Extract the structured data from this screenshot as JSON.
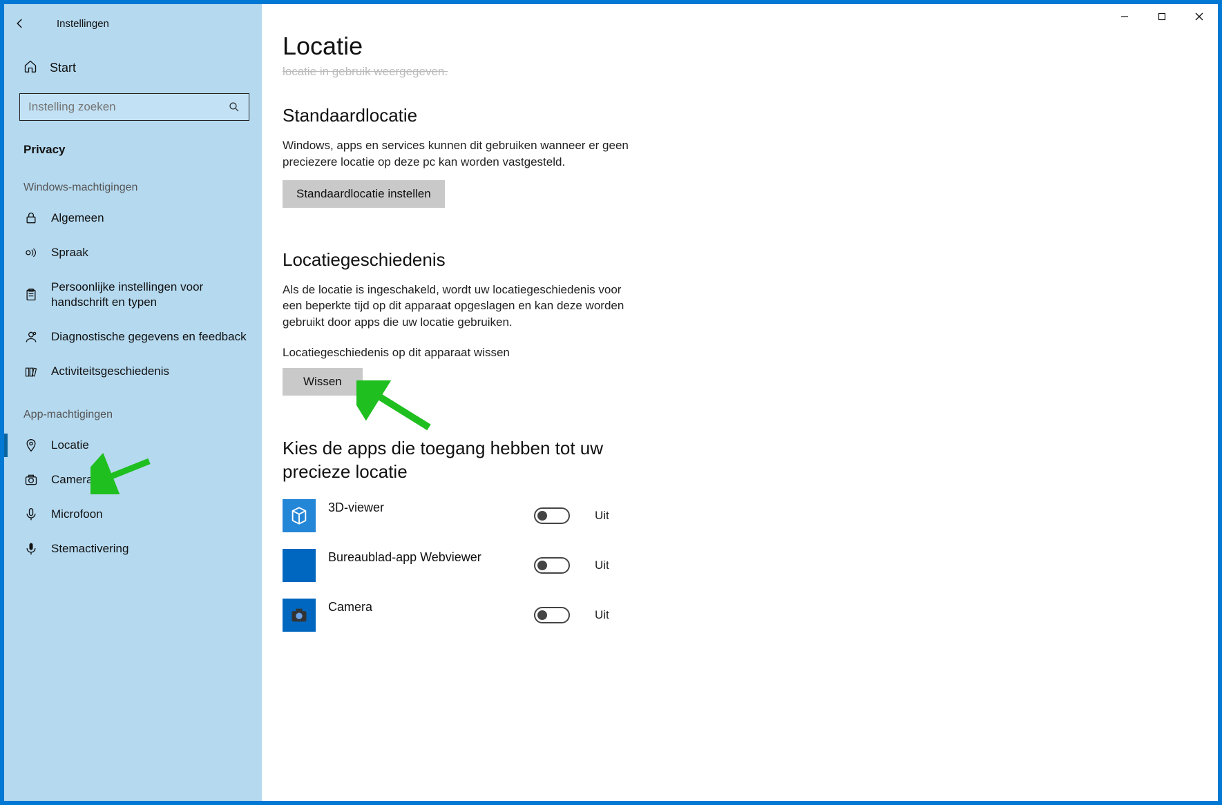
{
  "window": {
    "title": "Instellingen"
  },
  "sidebar": {
    "home": "Start",
    "search_placeholder": "Instelling zoeken",
    "category": "Privacy",
    "group_windows": "Windows-machtigingen",
    "group_apps": "App-machtigingen",
    "items_windows": [
      {
        "label": "Algemeen"
      },
      {
        "label": "Spraak"
      },
      {
        "label": "Persoonlijke instellingen voor handschrift en typen"
      },
      {
        "label": "Diagnostische gegevens en feedback"
      },
      {
        "label": "Activiteitsgeschiedenis"
      }
    ],
    "items_apps": [
      {
        "label": "Locatie"
      },
      {
        "label": "Camera"
      },
      {
        "label": "Microfoon"
      },
      {
        "label": "Stemactivering"
      }
    ]
  },
  "page": {
    "title": "Locatie",
    "clipped": "locatie in gebruik weergegeven.",
    "default_heading": "Standaardlocatie",
    "default_desc": "Windows, apps en services kunnen dit gebruiken wanneer er geen preciezere locatie op deze pc kan worden vastgesteld.",
    "default_button": "Standaardlocatie instellen",
    "history_heading": "Locatiegeschiedenis",
    "history_desc": "Als de locatie is ingeschakeld, wordt uw locatiegeschiedenis voor een beperkte tijd op dit apparaat opgeslagen en kan deze worden gebruikt door apps die uw locatie gebruiken.",
    "history_clear_label": "Locatiegeschiedenis op dit apparaat wissen",
    "history_clear_button": "Wissen",
    "apps_heading": "Kies de apps die toegang hebben tot uw precieze locatie",
    "apps": [
      {
        "name": "3D-viewer",
        "state": "Uit"
      },
      {
        "name": "Bureaublad-app Webviewer",
        "state": "Uit"
      },
      {
        "name": "Camera",
        "state": "Uit"
      }
    ]
  }
}
